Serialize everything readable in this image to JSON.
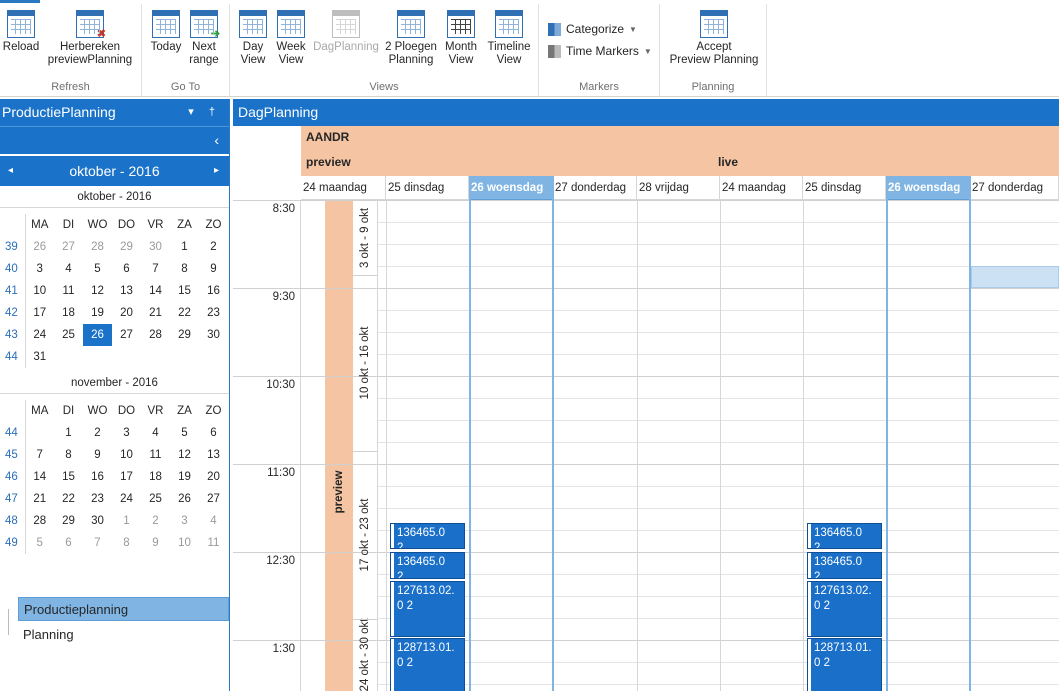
{
  "ribbon": {
    "groups": {
      "refresh": "Refresh",
      "goto": "Go To",
      "views": "Views",
      "markers": "Markers",
      "planning": "Planning"
    },
    "buttons": {
      "reload": "Reload",
      "recalc_1": "Herbereken",
      "recalc_2": "previewPlanning",
      "today": "Today",
      "next_1": "Next",
      "next_2": "range",
      "day_1": "Day",
      "day_2": "View",
      "week_1": "Week",
      "week_2": "View",
      "dagplanning": "DagPlanning",
      "ploegen_1": "2 Ploegen",
      "ploegen_2": "Planning",
      "month_1": "Month",
      "month_2": "View",
      "timeline_1": "Timeline",
      "timeline_2": "View",
      "accept_1": "Accept",
      "accept_2": "Preview Planning"
    },
    "markers": {
      "categorize": "Categorize",
      "time_markers": "Time Markers"
    }
  },
  "left_pane": {
    "title": "ProductiePlanning",
    "pin_glyph": "▾  †",
    "collapse_glyph": "‹",
    "nav": {
      "label": "oktober - 2016",
      "prev": "◂",
      "next": "▸"
    },
    "weekday_headers": [
      "MA",
      "DI",
      "WO",
      "DO",
      "VR",
      "ZA",
      "ZO"
    ],
    "months": [
      {
        "caption": "oktober - 2016",
        "weeks": [
          {
            "wk": "39",
            "days": [
              "26",
              "27",
              "28",
              "29",
              "30",
              "1",
              "2"
            ],
            "dim": [
              true,
              true,
              true,
              true,
              true,
              false,
              false
            ]
          },
          {
            "wk": "40",
            "days": [
              "3",
              "4",
              "5",
              "6",
              "7",
              "8",
              "9"
            ],
            "dim": [
              false,
              false,
              false,
              false,
              false,
              false,
              false
            ]
          },
          {
            "wk": "41",
            "days": [
              "10",
              "11",
              "12",
              "13",
              "14",
              "15",
              "16"
            ],
            "dim": [
              false,
              false,
              false,
              false,
              false,
              false,
              false
            ]
          },
          {
            "wk": "42",
            "days": [
              "17",
              "18",
              "19",
              "20",
              "21",
              "22",
              "23"
            ],
            "dim": [
              false,
              false,
              false,
              false,
              false,
              false,
              false
            ]
          },
          {
            "wk": "43",
            "days": [
              "24",
              "25",
              "26",
              "27",
              "28",
              "29",
              "30"
            ],
            "dim": [
              false,
              false,
              false,
              false,
              false,
              false,
              false
            ]
          },
          {
            "wk": "44",
            "days": [
              "31",
              "",
              "",
              "",
              "",
              "",
              ""
            ],
            "dim": [
              false,
              false,
              false,
              false,
              false,
              false,
              false
            ]
          }
        ],
        "selected_day": "26"
      },
      {
        "caption": "november - 2016",
        "weeks": [
          {
            "wk": "44",
            "days": [
              "",
              "1",
              "2",
              "3",
              "4",
              "5",
              "6"
            ],
            "dim": [
              false,
              false,
              false,
              false,
              false,
              false,
              false
            ]
          },
          {
            "wk": "45",
            "days": [
              "7",
              "8",
              "9",
              "10",
              "11",
              "12",
              "13"
            ],
            "dim": [
              false,
              false,
              false,
              false,
              false,
              false,
              false
            ]
          },
          {
            "wk": "46",
            "days": [
              "14",
              "15",
              "16",
              "17",
              "18",
              "19",
              "20"
            ],
            "dim": [
              false,
              false,
              false,
              false,
              false,
              false,
              false
            ]
          },
          {
            "wk": "47",
            "days": [
              "21",
              "22",
              "23",
              "24",
              "25",
              "26",
              "27"
            ],
            "dim": [
              false,
              false,
              false,
              false,
              false,
              false,
              false
            ]
          },
          {
            "wk": "48",
            "days": [
              "28",
              "29",
              "30",
              "1",
              "2",
              "3",
              "4"
            ],
            "dim": [
              false,
              false,
              false,
              true,
              true,
              true,
              true
            ]
          },
          {
            "wk": "49",
            "days": [
              "5",
              "6",
              "7",
              "8",
              "9",
              "10",
              "11"
            ],
            "dim": [
              true,
              true,
              true,
              true,
              true,
              true,
              true
            ]
          }
        ],
        "selected_day": ""
      }
    ],
    "tree": [
      "Productieplanning",
      "Planning"
    ]
  },
  "scheduler": {
    "title": "DagPlanning",
    "resource": "AANDR",
    "groups": [
      "preview",
      "live"
    ],
    "days": [
      "24 maandag",
      "25 dinsdag",
      "26 woensdag",
      "27 donderdag",
      "28 vrijdag",
      "24 maandag",
      "25 dinsdag",
      "26 woensdag",
      "27 donderdag"
    ],
    "today_index": [
      2,
      7
    ],
    "times": [
      "8:30",
      "9:30",
      "10:30",
      "11:30",
      "12:30",
      "1:30"
    ],
    "group_bar_label": "preview",
    "week_labels": [
      "3 okt - 9 okt",
      "10 okt - 16 okt",
      "17 okt - 23 okt",
      "24 okt - 30 okt"
    ],
    "appointments": [
      {
        "text": "136465.02..."
      },
      {
        "text": "136465.02..."
      },
      {
        "text": "127613.02.0 2"
      },
      {
        "text": "128713.01.0 2"
      },
      {
        "text": "136465.02..."
      },
      {
        "text": "136465.02..."
      },
      {
        "text": "127613.02.0 2"
      },
      {
        "text": "128713.01.0 2"
      }
    ]
  },
  "colors": {
    "accent": "#1a73c9",
    "resource_band": "#f5c4a2",
    "today_header": "#7fb4e3",
    "appointment": "#1a6fc8"
  }
}
